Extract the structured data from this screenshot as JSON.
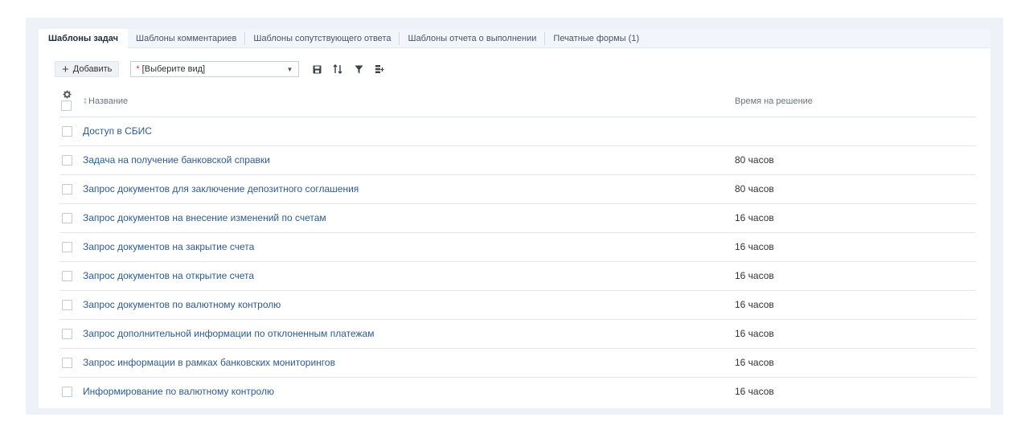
{
  "tabs": [
    {
      "label": "Шаблоны задач",
      "active": true
    },
    {
      "label": "Шаблоны комментариев",
      "active": false
    },
    {
      "label": "Шаблоны сопутствующего ответа",
      "active": false
    },
    {
      "label": "Шаблоны отчета о выполнении",
      "active": false
    },
    {
      "label": "Печатные формы (1)",
      "active": false
    }
  ],
  "toolbar": {
    "add_label": "Добавить",
    "select_required_mark": "*",
    "select_value": "[Выберите вид]",
    "icons": [
      "save-icon",
      "sort-icon",
      "filter-icon",
      "add-column-icon"
    ]
  },
  "table": {
    "columns": {
      "name": "Название",
      "name_sort_mark": "⁑",
      "time": "Время на решение"
    },
    "rows": [
      {
        "name": "Доступ в СБИС",
        "time": ""
      },
      {
        "name": "Задача на получение банковской справки",
        "time": "80 часов"
      },
      {
        "name": "Запрос документов для заключение депозитного соглашения",
        "time": "80 часов"
      },
      {
        "name": "Запрос документов на внесение изменений по счетам",
        "time": "16 часов"
      },
      {
        "name": "Запрос документов на закрытие счета",
        "time": "16 часов"
      },
      {
        "name": "Запрос документов на открытие счета",
        "time": "16 часов"
      },
      {
        "name": "Запрос документов по валютному контролю",
        "time": "16 часов"
      },
      {
        "name": "Запрос дополнительной информации по отклоненным платежам",
        "time": "16 часов"
      },
      {
        "name": "Запрос информации в рамках банковских мониторингов",
        "time": "16 часов"
      },
      {
        "name": "Информирование по валютному контролю",
        "time": "16 часов"
      }
    ]
  },
  "colors": {
    "link": "#2d5a96",
    "required": "#e03131",
    "frame_bg": "#eef2f8"
  }
}
